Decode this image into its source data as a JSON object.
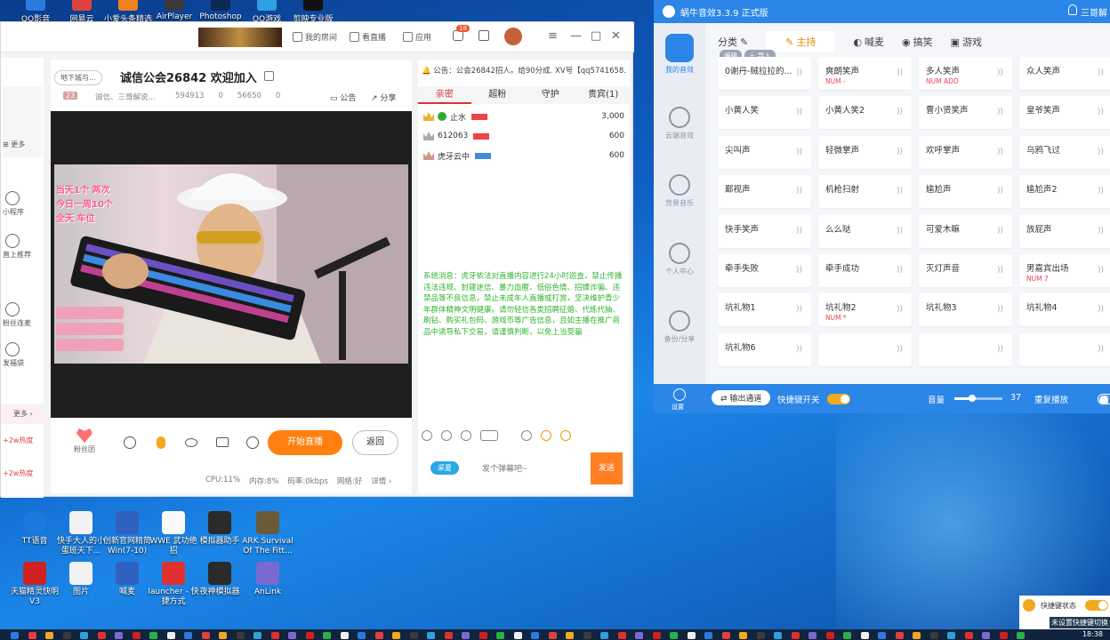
{
  "desktop": {
    "top_icons": [
      "QQ影音",
      "网易云",
      "小爱头条精选",
      "AirPlayer",
      "Photoshop",
      "QQ游戏",
      "剪映专业版"
    ],
    "icons_row1": [
      "TT语音",
      "快手大人的小蛋班天下...",
      "创新官网精简Win(7-10)",
      "WWE 武功绝招",
      "模拟器助手",
      "ARK Survival Of The Fitt..."
    ],
    "icons_row2": [
      "天猫精灵快明 V3",
      "图片",
      "喊麦",
      "launcher - 快捷方式",
      "夜神模拟器",
      "AnLink"
    ],
    "clock": "18:38"
  },
  "live": {
    "tabs": [
      "我的房间",
      "看直播",
      "应用"
    ],
    "badge": "18",
    "category": "地下城与...",
    "room_title": "诚信公会26842 欢迎加入",
    "level": "23",
    "anchor": "诚信、三哥解说...",
    "stats": [
      "594913",
      "0",
      "56650",
      "0"
    ],
    "notice": "公告",
    "share": "分享",
    "left_nav": [
      "更多",
      "小程序",
      "直上推荐",
      "粉丝连麦",
      "发福袋",
      "更多",
      "+2w热度",
      "+2w热度"
    ],
    "overlay": [
      "当天1个 两次",
      "今日一周10个",
      "全天 车位"
    ],
    "controls": {
      "fans": "粉丝团",
      "start": "开始直播",
      "back": "返回"
    },
    "status": [
      "CPU:11%",
      "内存:8%",
      "码率:0kbps",
      "网络:好",
      "详情"
    ],
    "chat": {
      "announcement": "公告：公会26842招人。给90分成. XV号【qq5741658...",
      "tabs": [
        "亲密",
        "超粉",
        "守护",
        "贵宾(1)"
      ],
      "ranks": [
        {
          "name": "止水",
          "score": "3,000"
        },
        {
          "name": "612063",
          "score": "600"
        },
        {
          "name": "虎牙云中",
          "score": "600"
        }
      ],
      "system": "系统消息：虎牙依法对直播内容进行24小时巡查，禁止传播违法违规、封建迷信、暴力血腥、低俗色情、招嫖诈骗、违禁品等不良信息，禁止未成年人直播或打赏，坚决维护青少年群体精神文明健康。请勿轻信各类招聘征婚、代练代抽、刷钻、购买礼包码、游戏币等广告信息，且如主播在推广商品中诱导私下交易，请谨慎判断，以免上当受骗",
      "bubble": "采夏",
      "placeholder": "发个弹幕吧~",
      "send": "发送"
    }
  },
  "sound": {
    "title": "蜗牛音效3.3.9 正式版",
    "user": "三哥解",
    "side": [
      "我的音效",
      "云端音效",
      "背景音乐",
      "个人中心",
      "备份/分享",
      "设置"
    ],
    "category_label": "分类",
    "edit": "编辑",
    "import": "导入",
    "cats": [
      "主持",
      "喊麦",
      "搞笑",
      "游戏"
    ],
    "cells": [
      {
        "name": "0谢丹-贼拉拉的...",
        "key": ""
      },
      {
        "name": "爽朗笑声",
        "key": "NUM -"
      },
      {
        "name": "多人笑声",
        "key": "NUM ADD"
      },
      {
        "name": "众人笑声",
        "key": ""
      },
      {
        "name": "小黄人笑",
        "key": ""
      },
      {
        "name": "小黄人笑2",
        "key": ""
      },
      {
        "name": "曹小贤笑声",
        "key": ""
      },
      {
        "name": "皇爷笑声",
        "key": ""
      },
      {
        "name": "尖叫声",
        "key": ""
      },
      {
        "name": "轻微掌声",
        "key": ""
      },
      {
        "name": "欢呼掌声",
        "key": ""
      },
      {
        "name": "乌鸦飞过",
        "key": ""
      },
      {
        "name": "鄙视声",
        "key": ""
      },
      {
        "name": "机枪扫射",
        "key": ""
      },
      {
        "name": "尴尬声",
        "key": ""
      },
      {
        "name": "尴尬声2",
        "key": ""
      },
      {
        "name": "快手笑声",
        "key": ""
      },
      {
        "name": "么么哒",
        "key": ""
      },
      {
        "name": "可爱木嘛",
        "key": ""
      },
      {
        "name": "放屁声",
        "key": ""
      },
      {
        "name": "牵手失败",
        "key": ""
      },
      {
        "name": "牵手成功",
        "key": ""
      },
      {
        "name": "灭灯声音",
        "key": ""
      },
      {
        "name": "男嘉宾出场",
        "key": "NUM 7"
      },
      {
        "name": "坑礼物1",
        "key": ""
      },
      {
        "name": "坑礼物2",
        "key": "NUM *"
      },
      {
        "name": "坑礼物3",
        "key": ""
      },
      {
        "name": "坑礼物4",
        "key": ""
      },
      {
        "name": "坑礼物6",
        "key": ""
      },
      {
        "name": "",
        "key": ""
      },
      {
        "name": "",
        "key": ""
      },
      {
        "name": "",
        "key": ""
      }
    ],
    "bottom": {
      "output": "输出通道",
      "hotkey": "快捷键开关",
      "volume_label": "音量",
      "volume": "37",
      "repeat": "重复播放",
      "extra": "音"
    },
    "notify": {
      "title": "快捷键状态",
      "sub": "未设置快捷键切换"
    }
  }
}
